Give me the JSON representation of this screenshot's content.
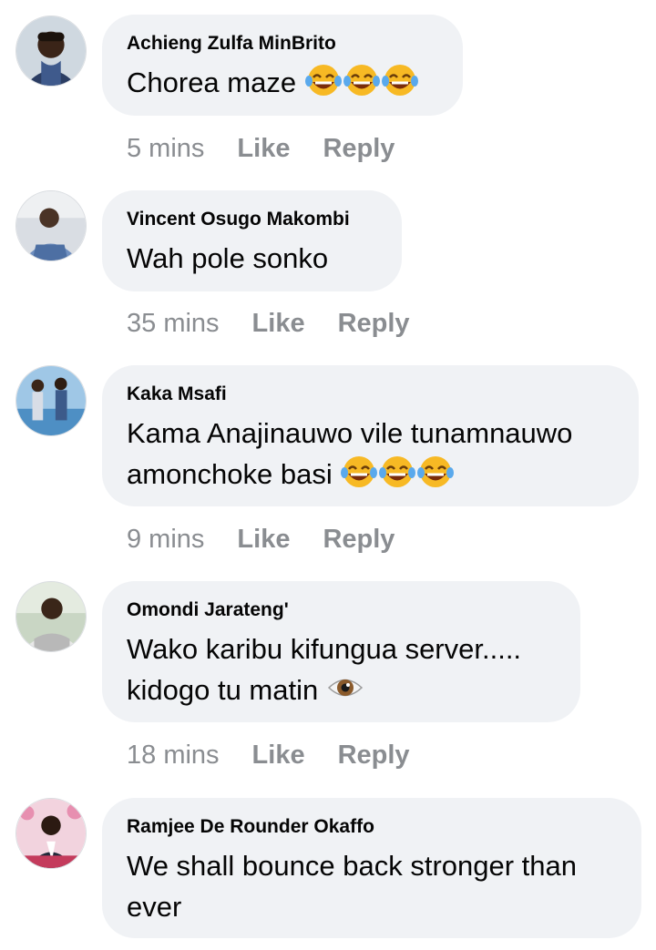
{
  "comments": [
    {
      "author": "Achieng Zulfa MinBrito",
      "text": "Chorea maze",
      "time": "5 mins",
      "like": "Like",
      "reply": "Reply",
      "emoji": [
        "joy-emoji",
        "joy-emoji",
        "joy-emoji"
      ]
    },
    {
      "author": "Vincent Osugo Makombi",
      "text": "Wah pole sonko",
      "time": "35 mins",
      "like": "Like",
      "reply": "Reply"
    },
    {
      "author": "Kaka Msafi",
      "text_line1": "Kama Anajinauwo vile tunamnauwo",
      "text_line2": "amonchoke basi",
      "time": "9 mins",
      "like": "Like",
      "reply": "Reply",
      "emoji": [
        "joy-emoji",
        "joy-emoji",
        "joy-emoji"
      ]
    },
    {
      "author": "Omondi Jarateng'",
      "text_line1": "Wako karibu kifungua server.....",
      "text_line2": "kidogo tu matin",
      "time": "18 mins",
      "like": "Like",
      "reply": "Reply",
      "emoji": [
        "eye-emoji"
      ]
    },
    {
      "author": "Ramjee De Rounder Okaffo",
      "text_line1": "We shall bounce back stronger than",
      "text_line2": "ever"
    }
  ],
  "colors": {
    "bubble": "#f0f2f5",
    "meta": "#8a8d91",
    "text": "#050505"
  }
}
